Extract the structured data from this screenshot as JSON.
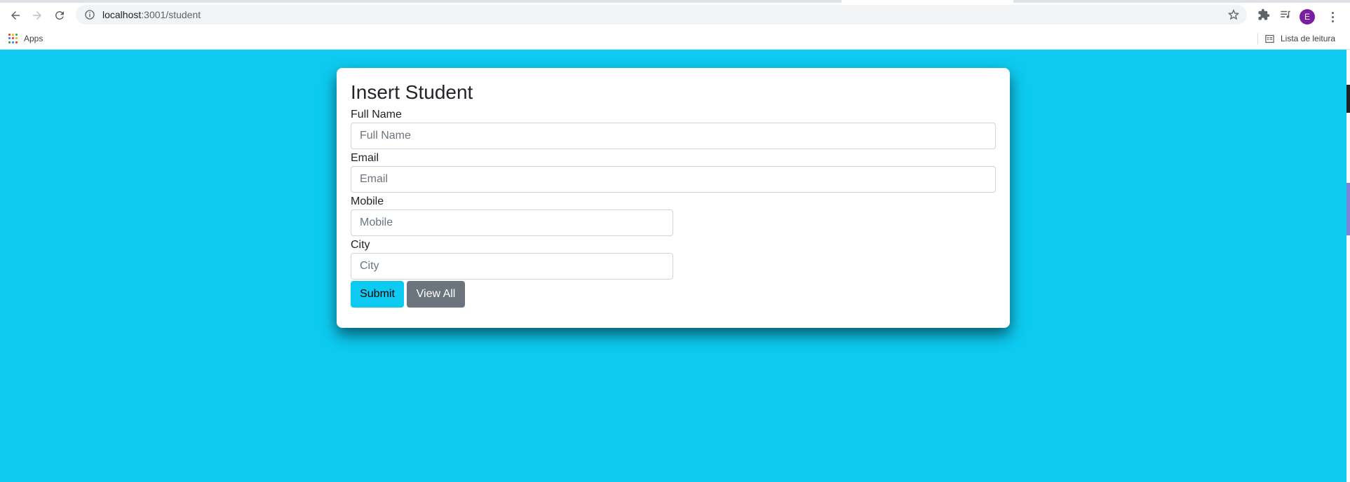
{
  "browser": {
    "url_host": "localhost",
    "url_path": ":3001/student",
    "avatar_letter": "E",
    "avatar_color": "#7b1fa2",
    "bookmarks": {
      "apps_label": "Apps",
      "reading_list_label": "Lista de leitura"
    }
  },
  "page": {
    "background_color": "#0dcaf0",
    "form": {
      "title": "Insert Student",
      "fields": [
        {
          "label": "Full Name",
          "placeholder": "Full Name",
          "value": ""
        },
        {
          "label": "Email",
          "placeholder": "Email",
          "value": ""
        },
        {
          "label": "Mobile",
          "placeholder": "Mobile",
          "value": ""
        },
        {
          "label": "City",
          "placeholder": "City",
          "value": ""
        }
      ],
      "submit_label": "Submit",
      "view_all_label": "View All"
    }
  },
  "colors": {
    "submit_button": "#0dcaf0",
    "view_all_button": "#6c757d"
  }
}
